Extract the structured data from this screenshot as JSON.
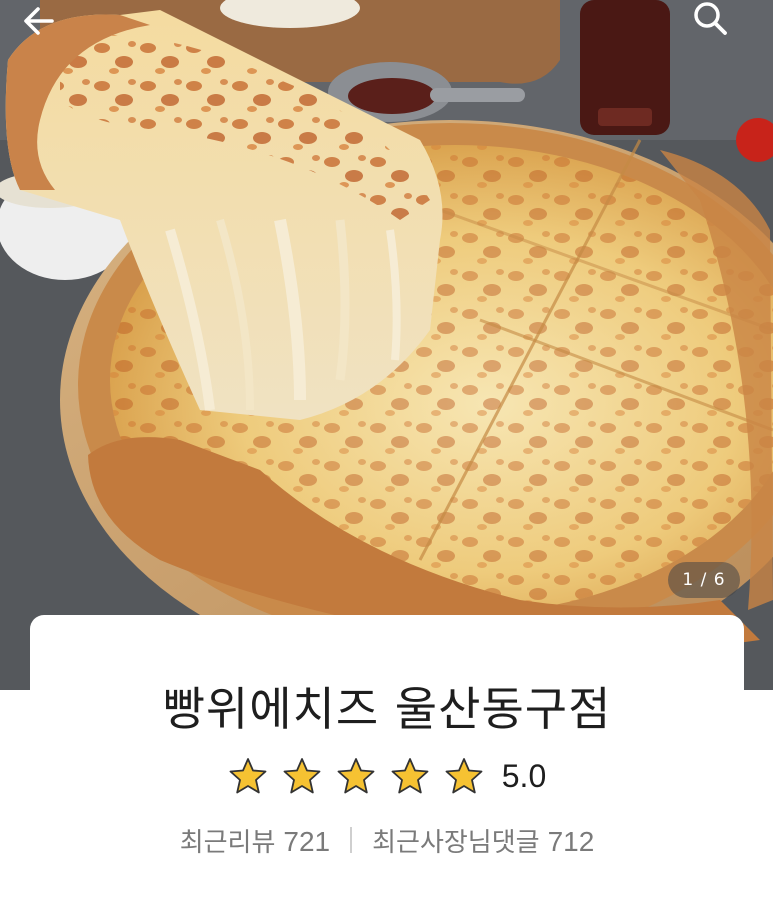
{
  "header": {
    "back_icon": "arrow-left-icon",
    "search_icon": "search-icon"
  },
  "hero": {
    "image_subject": "cheese pizza",
    "page_indicator": "1 / 6",
    "current_page": 1,
    "total_pages": 6
  },
  "store": {
    "name": "빵위에치즈 울산동구점",
    "rating_stars": 5,
    "rating_value": "5.0",
    "star_color": "#f6c232"
  },
  "stats": {
    "reviews_label": "최근리뷰",
    "reviews_count": "721",
    "owner_comments_label": "최근사장님댓글",
    "owner_comments_count": "712"
  }
}
